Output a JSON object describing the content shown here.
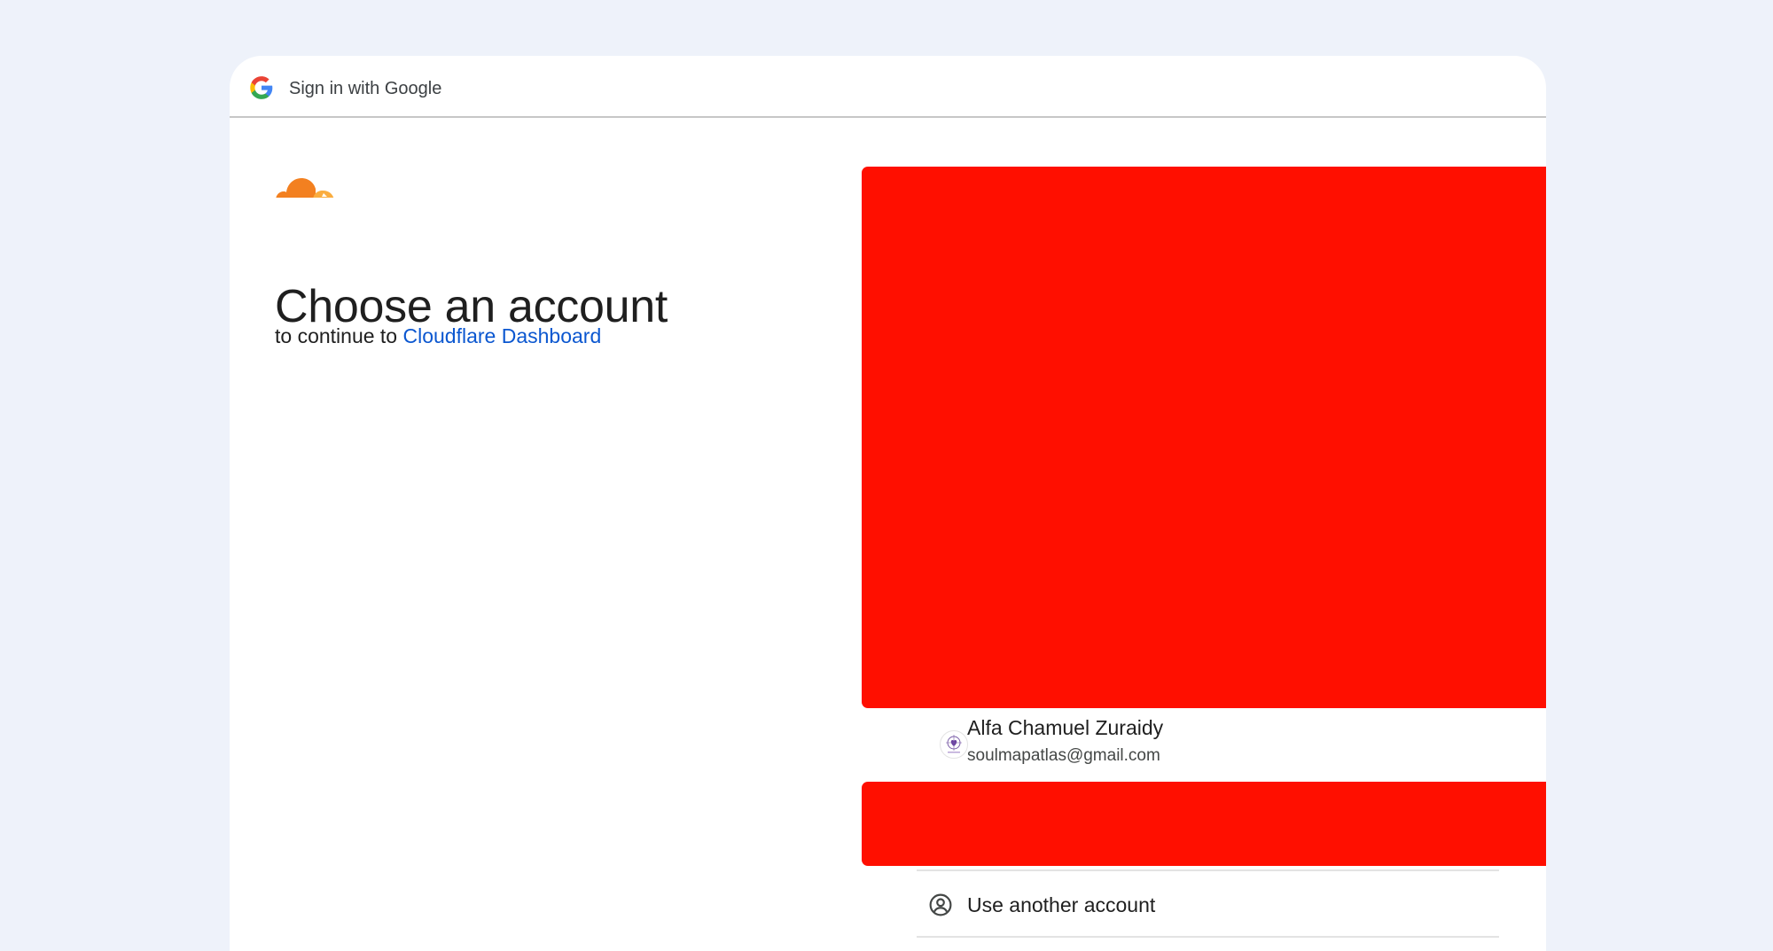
{
  "header": {
    "title": "Sign in with Google",
    "logo_icon": "google-g-icon"
  },
  "main": {
    "brand_icon": "cloudflare-cloud-icon",
    "headline": "Choose an account",
    "subtitle_prefix": "to continue to",
    "app_link": "Cloudflare Dashboard"
  },
  "accounts": [
    {
      "name": "Alfa Chamuel Zuraidy",
      "email": "soulmapatlas@gmail.com",
      "avatar_icon": "soul-map-atlas-avatar"
    }
  ],
  "use_another": {
    "label": "Use another account",
    "icon": "account-circle-icon"
  },
  "colors": {
    "page_background": "#eef2fa",
    "card_background": "#ffffff",
    "link": "#0b57d0",
    "redaction": "#ff0f00",
    "cloudflare_orange": "#f38020"
  }
}
